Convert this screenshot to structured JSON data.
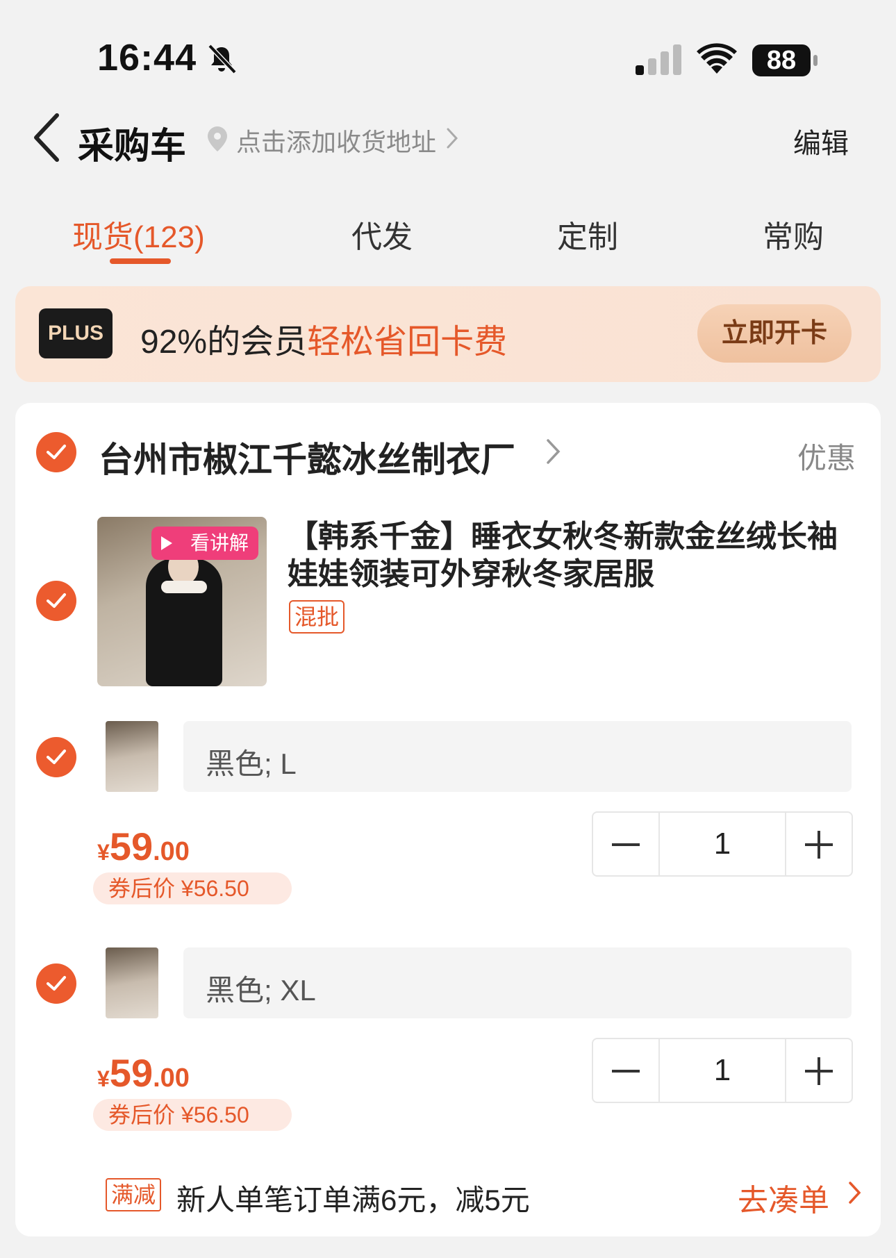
{
  "status_bar": {
    "time": "16:44",
    "battery": "88"
  },
  "nav": {
    "title": "采购车",
    "address_placeholder": "点击添加收货地址",
    "edit_label": "编辑"
  },
  "tabs": [
    {
      "label": "现货(123)",
      "active": true
    },
    {
      "label": "代发",
      "active": false
    },
    {
      "label": "定制",
      "active": false
    },
    {
      "label": "常购",
      "active": false
    }
  ],
  "plus_banner": {
    "logo": "PLUS",
    "text_prefix": "92%的会员",
    "text_highlight": "轻松省回卡费",
    "button_label": "立即开卡"
  },
  "shop": {
    "name": "台州市椒江千懿冰丝制衣厂",
    "promo_label": "优惠",
    "product": {
      "video_badge": "看讲解",
      "title": "【韩系千金】睡衣女秋冬新款金丝绒长袖娃娃领装可外穿秋冬家居服",
      "tag": "混批",
      "skus": [
        {
          "spec": "黑色; L",
          "price_yen": "¥",
          "price_int": "59",
          "price_dec": ".00",
          "coupon_price": "券后价 ¥56.50",
          "quantity": "1"
        },
        {
          "spec": "黑色; XL",
          "price_yen": "¥",
          "price_int": "59",
          "price_dec": ".00",
          "coupon_price": "券后价 ¥56.50",
          "quantity": "1"
        }
      ]
    },
    "discount": {
      "tag": "满减",
      "text": "新人单笔订单满6元，减5元",
      "action_label": "去凑单"
    }
  },
  "colors": {
    "accent": "#e5582a",
    "check": "#ec5b2e",
    "background": "#f2f2f2"
  }
}
